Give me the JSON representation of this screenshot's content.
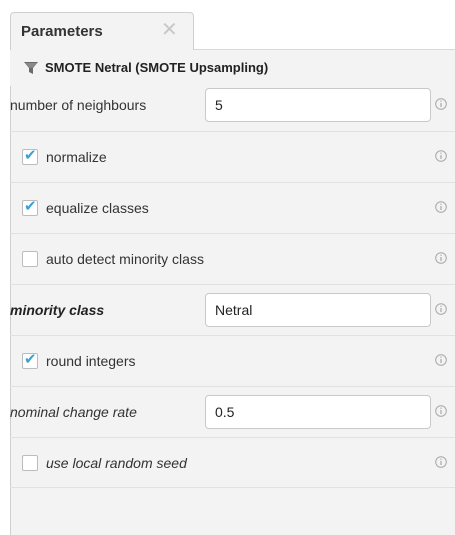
{
  "tab": {
    "label": "Parameters",
    "close_glyph": "✕"
  },
  "operator": {
    "icon": "funnel-icon",
    "title": "SMOTE Netral (SMOTE Upsampling)"
  },
  "params": [
    {
      "label": "number of neighbours",
      "type": "text",
      "value": "5"
    },
    {
      "label": "normalize",
      "type": "checkbox",
      "checked": true
    },
    {
      "label": "equalize classes",
      "type": "checkbox",
      "checked": true
    },
    {
      "label": "auto detect minority class",
      "type": "checkbox",
      "checked": false
    },
    {
      "label": "minority class",
      "type": "text",
      "value": "Netral"
    },
    {
      "label": "round integers",
      "type": "checkbox",
      "checked": true
    },
    {
      "label": "nominal change rate",
      "type": "text",
      "value": "0.5"
    },
    {
      "label": "use local random seed",
      "type": "checkbox",
      "checked": false
    }
  ],
  "colors": {
    "check_accent": "#3aa0d8",
    "panel_bg": "#f3f3f3",
    "icon_gray": "#a8a8a8"
  },
  "icons": {
    "check": "✔",
    "info": "info-icon"
  }
}
